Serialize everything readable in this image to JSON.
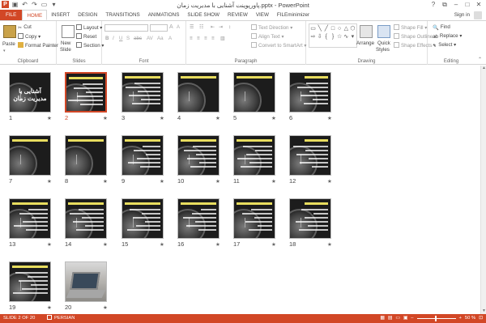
{
  "window": {
    "title": "پاورپوینت آشنایی با مدیریت زمان.pptx - PowerPoint",
    "app_icon": "P",
    "help": "?",
    "sign_in": "Sign in"
  },
  "tabs": [
    "FILE",
    "HOME",
    "INSERT",
    "DESIGN",
    "TRANSITIONS",
    "ANIMATIONS",
    "SLIDE SHOW",
    "REVIEW",
    "VIEW",
    "FILEminimizer"
  ],
  "active_tab": "HOME",
  "ribbon": {
    "clipboard": {
      "paste": "Paste",
      "cut": "Cut",
      "copy": "Copy",
      "format_painter": "Format Painter",
      "label": "Clipboard"
    },
    "slides": {
      "new_slide_1": "New",
      "new_slide_2": "Slide",
      "layout": "Layout",
      "reset": "Reset",
      "section": "Section",
      "label": "Slides"
    },
    "font": {
      "label": "Font"
    },
    "paragraph": {
      "text_direction": "Text Direction",
      "align_text": "Align Text",
      "convert_smartart": "Convert to SmartArt",
      "label": "Paragraph"
    },
    "drawing": {
      "arrange": "Arrange",
      "quick_styles_1": "Quick",
      "quick_styles_2": "Styles",
      "shape_fill": "Shape Fill",
      "shape_outline": "Shape Outline",
      "shape_effects": "Shape Effects",
      "label": "Drawing"
    },
    "editing": {
      "find": "Find",
      "replace": "Replace",
      "select": "Select",
      "label": "Editing"
    }
  },
  "slides": [
    {
      "num": "1",
      "title": "آشنایی با مدیریت زمان"
    },
    {
      "num": "2"
    },
    {
      "num": "3"
    },
    {
      "num": "4"
    },
    {
      "num": "5"
    },
    {
      "num": "6"
    },
    {
      "num": "7"
    },
    {
      "num": "8"
    },
    {
      "num": "9"
    },
    {
      "num": "10"
    },
    {
      "num": "11"
    },
    {
      "num": "12"
    },
    {
      "num": "13"
    },
    {
      "num": "14"
    },
    {
      "num": "15"
    },
    {
      "num": "16"
    },
    {
      "num": "17"
    },
    {
      "num": "18"
    },
    {
      "num": "19"
    },
    {
      "num": "20"
    }
  ],
  "star": "★",
  "selected_slide": 2,
  "status": {
    "slide_info": "SLIDE 2 OF 20",
    "language": "PERSIAN",
    "zoom": "50 %"
  },
  "colors": {
    "accent": "#d24726"
  }
}
